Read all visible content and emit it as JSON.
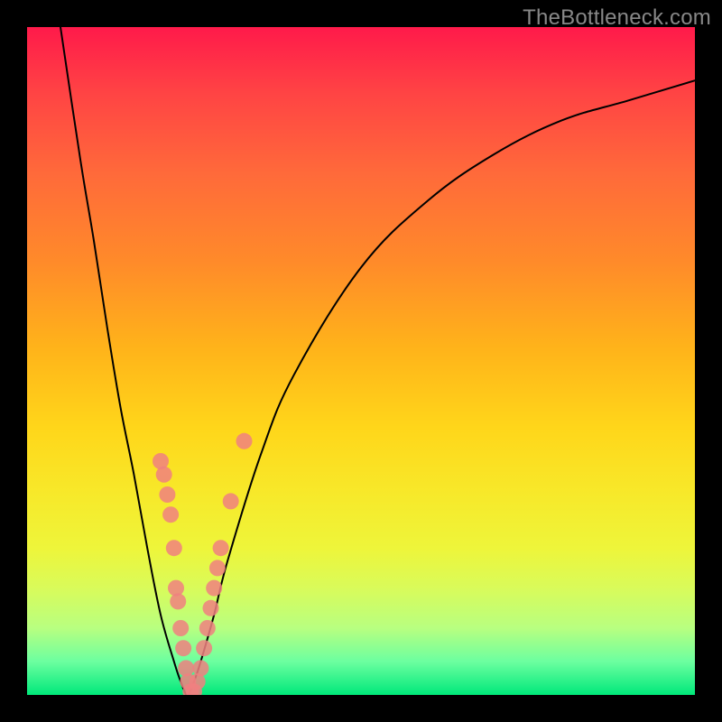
{
  "watermark": "TheBottleneck.com",
  "chart_data": {
    "type": "line",
    "title": "",
    "xlabel": "",
    "ylabel": "",
    "xlim": [
      0,
      100
    ],
    "ylim": [
      0,
      100
    ],
    "grid": false,
    "legend": false,
    "series": [
      {
        "name": "bottleneck-curve",
        "x": [
          5,
          8,
          10,
          12,
          14,
          16,
          18,
          20,
          22,
          23,
          24,
          25,
          26,
          28,
          30,
          35,
          40,
          50,
          60,
          70,
          80,
          90,
          100
        ],
        "y": [
          100,
          80,
          68,
          55,
          43,
          33,
          22,
          12,
          5,
          2,
          0,
          2,
          5,
          12,
          20,
          36,
          48,
          64,
          74,
          81,
          86,
          89,
          92
        ]
      }
    ],
    "markers": {
      "name": "highlighted-points",
      "color": "#f08080",
      "points": [
        {
          "x_pct": 20.0,
          "y_pct": 35
        },
        {
          "x_pct": 20.5,
          "y_pct": 33
        },
        {
          "x_pct": 21.0,
          "y_pct": 30
        },
        {
          "x_pct": 21.5,
          "y_pct": 27
        },
        {
          "x_pct": 22.0,
          "y_pct": 22
        },
        {
          "x_pct": 22.3,
          "y_pct": 16
        },
        {
          "x_pct": 22.6,
          "y_pct": 14
        },
        {
          "x_pct": 23.0,
          "y_pct": 10
        },
        {
          "x_pct": 23.4,
          "y_pct": 7
        },
        {
          "x_pct": 23.8,
          "y_pct": 4
        },
        {
          "x_pct": 24.1,
          "y_pct": 2
        },
        {
          "x_pct": 24.5,
          "y_pct": 0.5
        },
        {
          "x_pct": 25.0,
          "y_pct": 0.5
        },
        {
          "x_pct": 25.5,
          "y_pct": 2
        },
        {
          "x_pct": 26.0,
          "y_pct": 4
        },
        {
          "x_pct": 26.5,
          "y_pct": 7
        },
        {
          "x_pct": 27.0,
          "y_pct": 10
        },
        {
          "x_pct": 27.5,
          "y_pct": 13
        },
        {
          "x_pct": 28.0,
          "y_pct": 16
        },
        {
          "x_pct": 28.5,
          "y_pct": 19
        },
        {
          "x_pct": 29.0,
          "y_pct": 22
        },
        {
          "x_pct": 30.5,
          "y_pct": 29
        },
        {
          "x_pct": 32.5,
          "y_pct": 38
        }
      ]
    }
  }
}
